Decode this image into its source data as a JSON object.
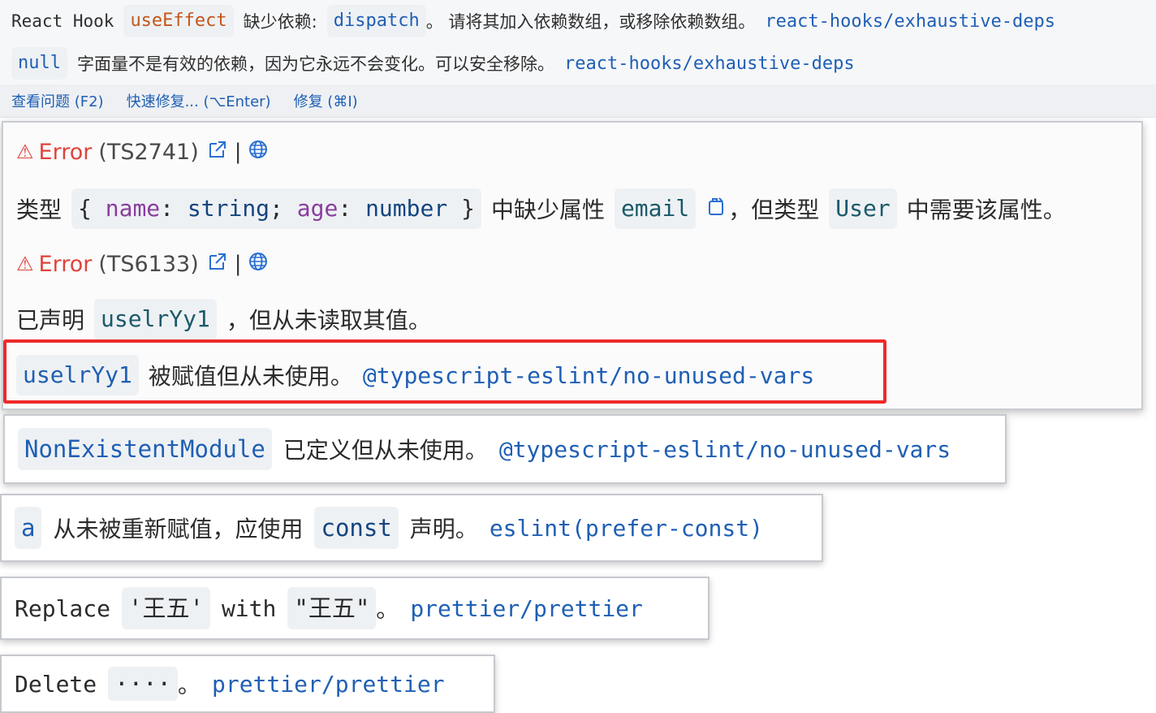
{
  "top": {
    "row1": {
      "prefix": "React Hook",
      "hook": "useEffect",
      "text1": "缺少依赖:",
      "dep": "dispatch",
      "text2": "。 请将其加入依赖数组，或移除依赖数组。",
      "rule": "react-hooks/exhaustive-deps"
    },
    "row2": {
      "code": "null",
      "text": "字面量不是有效的依赖，因为它永远不会变化。可以安全移除。",
      "rule": "react-hooks/exhaustive-deps"
    },
    "actions": {
      "view_problem": "查看问题 (F2)",
      "quick_fix": "快速修复... (⌥Enter)",
      "fix": "修复 (⌘I)"
    }
  },
  "panel": {
    "error1": {
      "label": "Error",
      "code": "(TS2741)",
      "msg_prefix": "类型",
      "type_open": "{",
      "p1": "name",
      "colon1": ":",
      "t1": "string",
      "semi": ";",
      "p2": "age",
      "colon2": ":",
      "t2": "number",
      "type_close": "}",
      "msg_mid": "中缺少属性",
      "prop": "email",
      "msg_mid2": "，但类型",
      "type_name": "User",
      "msg_end": "中需要该属性。"
    },
    "error2": {
      "label": "Error",
      "code": "(TS6133)",
      "msg_prefix": "已声明",
      "var": "uselrYy1",
      "msg_end": "，但从未读取其值。"
    },
    "lint1": {
      "var": "uselrYy1",
      "text": "被赋值但从未使用。",
      "rule": "@typescript-eslint/no-unused-vars"
    }
  },
  "sub1": {
    "var": "NonExistentModule",
    "text": "已定义但从未使用。",
    "rule": "@typescript-eslint/no-unused-vars"
  },
  "sub2": {
    "var": "a",
    "text1": "从未被重新赋值，应使用",
    "kw": "const",
    "text2": "声明。",
    "rule": "eslint(prefer-const)"
  },
  "sub3": {
    "word1": "Replace",
    "from": "'王五'",
    "word2": "with",
    "to": "\"王五\"",
    "dot": "。",
    "rule": "prettier/prettier"
  },
  "sub4": {
    "word": "Delete",
    "what": "····",
    "dot": "。",
    "rule": "prettier/prettier"
  },
  "icons": {
    "warning": "warning-icon",
    "external_link": "external-link-icon",
    "globe": "globe-icon",
    "copy": "copy-icon"
  },
  "colors": {
    "error": "#e0443b",
    "rule_link": "#1f5fb4",
    "highlight_box": "#ee2a2a"
  }
}
